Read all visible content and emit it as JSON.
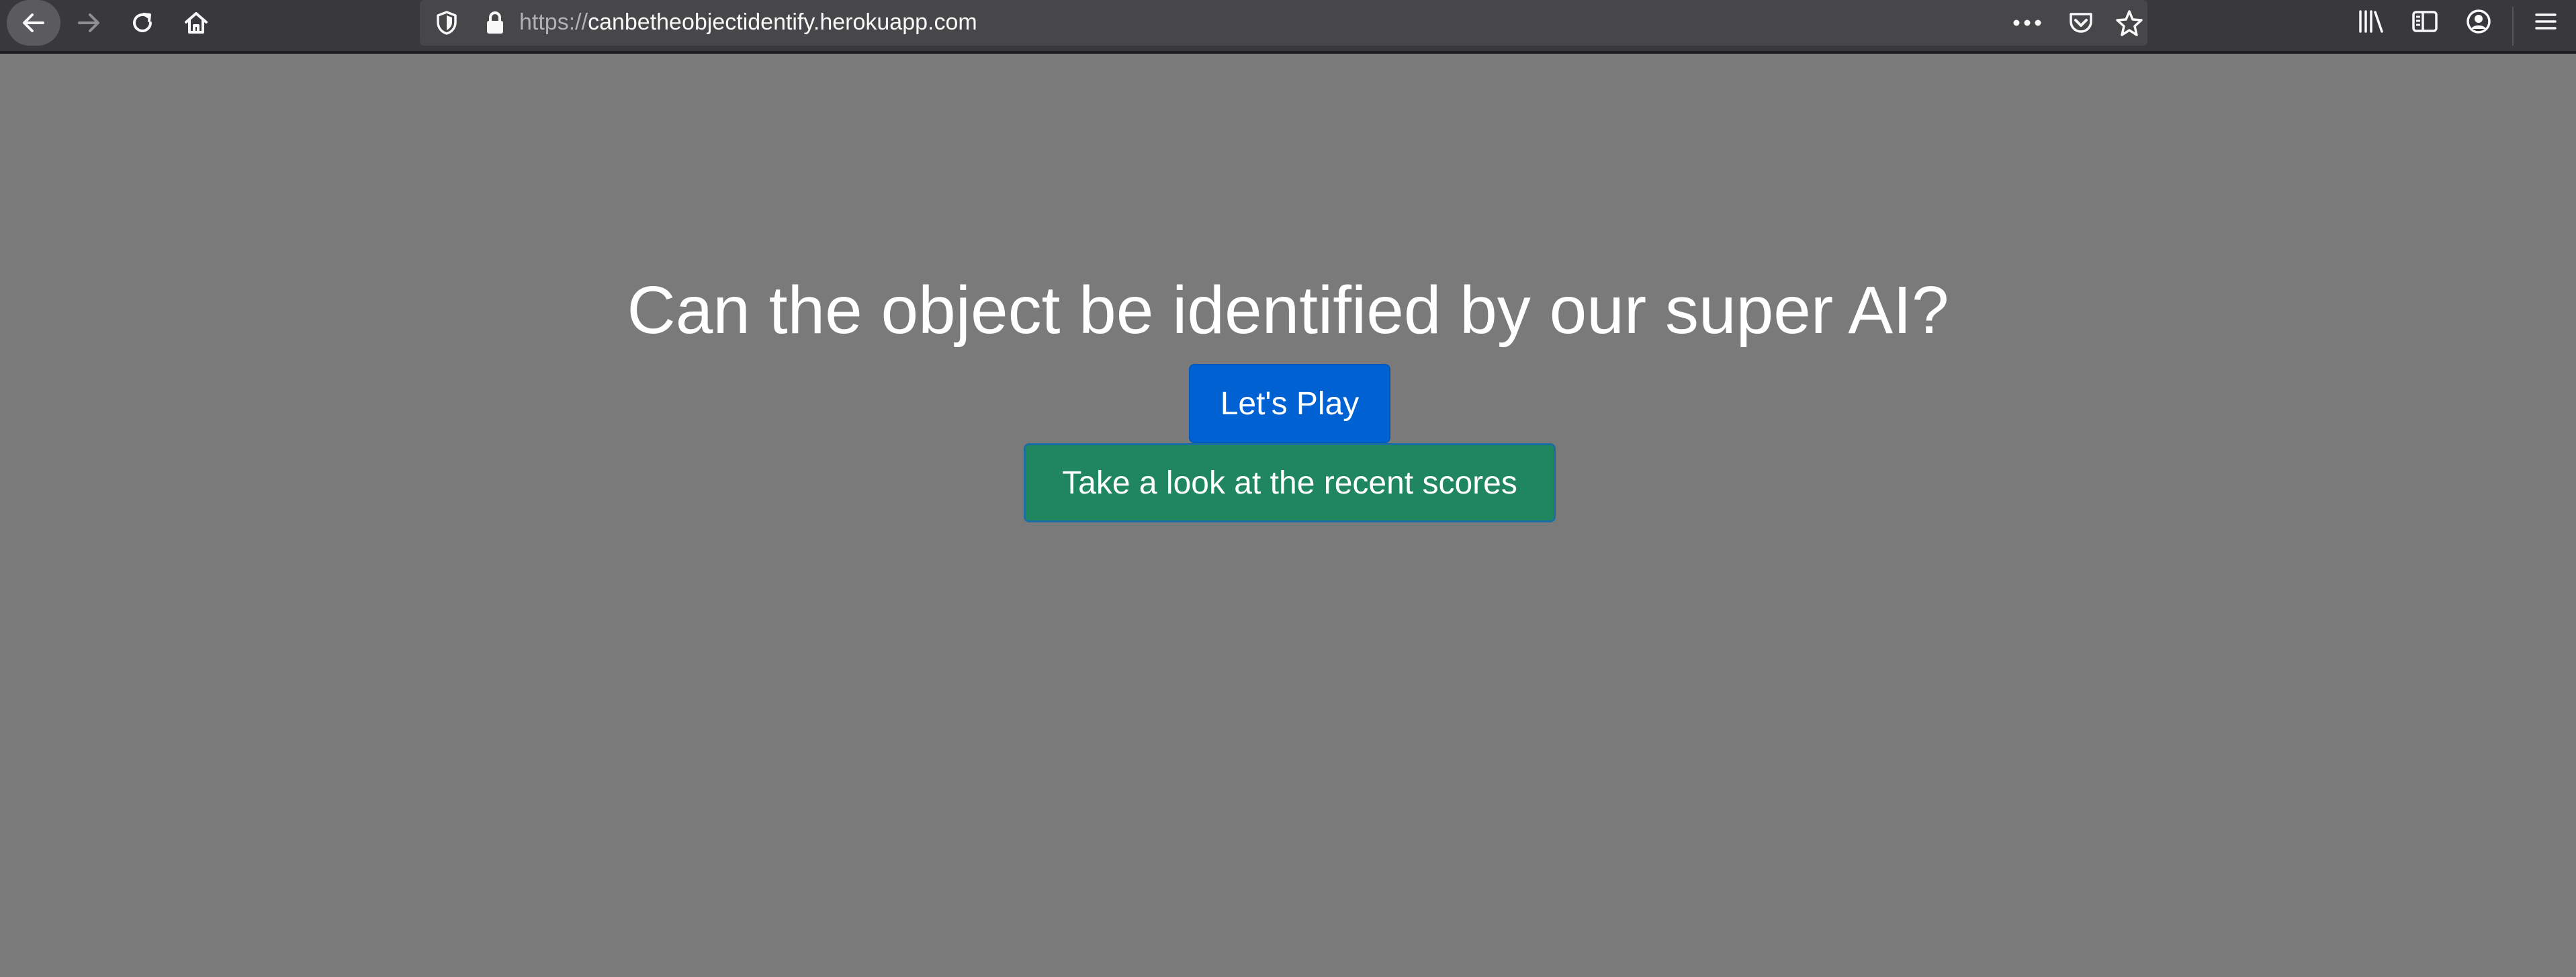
{
  "browser": {
    "url_scheme": "https://",
    "url_host": "canbetheobjectidentify.herokuapp.com",
    "icons": {
      "back": "back-arrow-icon",
      "forward": "forward-arrow-icon",
      "reload": "reload-icon",
      "home": "home-icon",
      "tracking": "shield-icon",
      "secure": "lock-icon",
      "page_actions": "more-dots-icon",
      "pocket": "pocket-icon",
      "bookmark": "star-icon",
      "library": "library-icon",
      "sidebar": "sidebar-icon",
      "account": "account-icon",
      "menu": "hamburger-menu-icon"
    }
  },
  "page": {
    "headline": "Can the object be identified by our super AI?",
    "play_button": "Let's Play",
    "scores_button": "Take a look at the recent scores"
  },
  "colors": {
    "page_background": "#7a7a7a",
    "play_button": "#0062d2",
    "scores_button": "#208660",
    "toolbar": "#38383d"
  }
}
